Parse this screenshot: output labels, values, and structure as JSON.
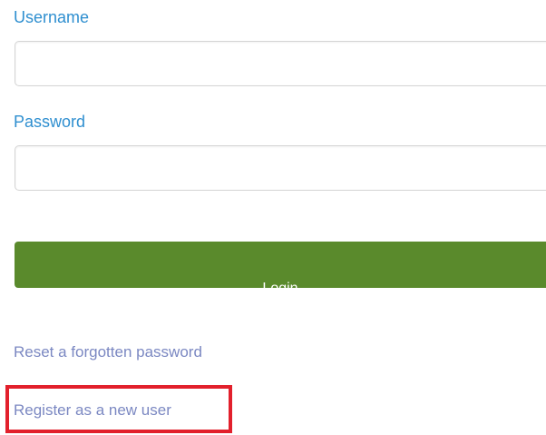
{
  "form": {
    "username_label": "Username",
    "username_value": "",
    "password_label": "Password",
    "password_value": "",
    "login_label": "Login"
  },
  "links": {
    "reset_password": "Reset a forgotten password",
    "register": "Register as a new user"
  },
  "colors": {
    "label": "#2f8fd0",
    "link": "#7b88c2",
    "button": "#5a8a2c",
    "highlight": "#e2202c"
  }
}
